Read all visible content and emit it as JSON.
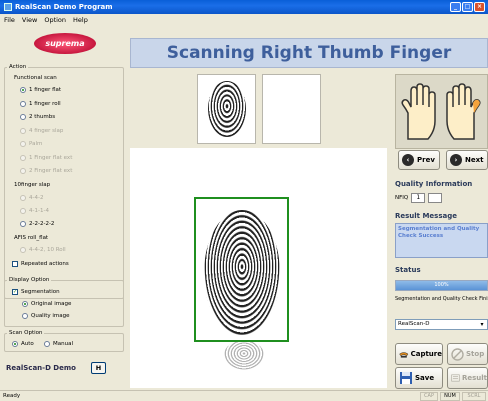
{
  "window": {
    "title": "RealScan Demo Program"
  },
  "menu": [
    "File",
    "View",
    "Option",
    "Help"
  ],
  "logo": {
    "text": "suprema"
  },
  "action": {
    "legend": "Action",
    "functional_label": "Functional scan",
    "functional_options": [
      {
        "label": "1 finger flat",
        "selected": true,
        "enabled": true
      },
      {
        "label": "1 finger roll",
        "selected": false,
        "enabled": true
      },
      {
        "label": "2 thumbs",
        "selected": false,
        "enabled": true
      },
      {
        "label": "4 finger slap",
        "selected": false,
        "enabled": false
      },
      {
        "label": "Palm",
        "selected": false,
        "enabled": false
      },
      {
        "label": "1 Finger flat ext",
        "selected": false,
        "enabled": false
      },
      {
        "label": "2 Finger flat ext",
        "selected": false,
        "enabled": false
      }
    ],
    "slap_label": "10finger slap",
    "slap_options": [
      {
        "label": "4-4-2",
        "selected": false,
        "enabled": false
      },
      {
        "label": "4-1-1-4",
        "selected": false,
        "enabled": false
      },
      {
        "label": "2-2-2-2-2",
        "selected": false,
        "enabled": true
      }
    ],
    "afis_label": "AFIS roll_flat",
    "afis_options": [
      {
        "label": "4-4-2, 10 Roll",
        "selected": false,
        "enabled": false
      }
    ],
    "repeated_label": "Repeated actions",
    "repeated_checked": false
  },
  "display": {
    "legend": "Display Option",
    "segmentation_label": "Segmentation",
    "segmentation_checked": true,
    "options": [
      {
        "label": "Original image",
        "selected": true
      },
      {
        "label": "Quality image",
        "selected": false
      }
    ]
  },
  "scan": {
    "legend": "Scan Option",
    "options": [
      {
        "label": "Auto",
        "selected": true
      },
      {
        "label": "Manual",
        "selected": false
      }
    ]
  },
  "footer_left": {
    "demo_label": "RealScan-D Demo",
    "h_button": "H"
  },
  "heading": "Scanning Right Thumb Finger",
  "nav": {
    "prev": "Prev",
    "next": "Next"
  },
  "quality": {
    "title": "Quality Information",
    "nfiq_label": "NFIQ",
    "nfiq_value": "1",
    "nfiq_value2": ""
  },
  "result": {
    "title": "Result Message",
    "message": "Segmentation and Quality Check Success"
  },
  "status": {
    "title": "Status",
    "progress_percent": 100,
    "progress_text": "100%",
    "text": "Segmentation and Quality Check Finished"
  },
  "device": {
    "selected": "RealScan-D"
  },
  "actions": {
    "capture": "Capture",
    "stop": "Stop",
    "save": "Save",
    "result": "Result"
  },
  "statusbar": {
    "text": "Ready",
    "cap": "CAP",
    "num": "NUM",
    "scrl": "SCRL"
  },
  "colors": {
    "heading_text": "#3e5f9c",
    "heading_bg": "#c9d6ea",
    "segment_box": "#1f8f1f",
    "hand_fill": "#fdeec8",
    "hand_selected": "#f5a33c"
  }
}
